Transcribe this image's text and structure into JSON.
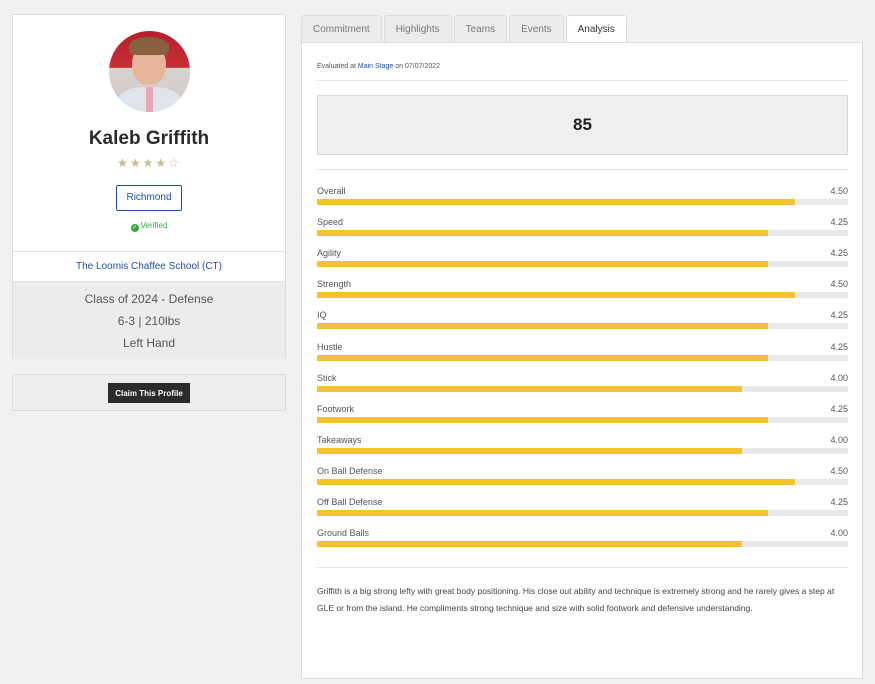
{
  "profile": {
    "name": "Kaleb Griffith",
    "stars": "★★★★",
    "stars_empty": "☆",
    "rating_stars": 4,
    "team": "Richmond",
    "verified": "Verified",
    "school": "The Loomis Chaffee School (CT)",
    "class_position": "Class of 2024 - Defense",
    "height_weight": "6-3 | 210lbs",
    "hand": "Left Hand",
    "claim_label": "Claim This Profile"
  },
  "tabs": [
    "Commitment",
    "Highlights",
    "Teams",
    "Events",
    "Analysis"
  ],
  "active_tab": 4,
  "analysis": {
    "eval_prefix": "Evaluated at",
    "eval_event": "Main Stage",
    "eval_on": "on",
    "eval_date": "07/07/2022",
    "score": "85",
    "max_value": 5,
    "metrics": [
      {
        "label": "Overall",
        "value": "4.50"
      },
      {
        "label": "Speed",
        "value": "4.25"
      },
      {
        "label": "Agility",
        "value": "4.25"
      },
      {
        "label": "Strength",
        "value": "4.50"
      },
      {
        "label": "IQ",
        "value": "4.25"
      },
      {
        "label": "Hustle",
        "value": "4.25"
      },
      {
        "label": "Stick",
        "value": "4.00"
      },
      {
        "label": "Footwork",
        "value": "4.25"
      },
      {
        "label": "Takeaways",
        "value": "4.00"
      },
      {
        "label": "On Ball Defense",
        "value": "4.50"
      },
      {
        "label": "Off Ball Defense",
        "value": "4.25"
      },
      {
        "label": "Ground Balls",
        "value": "4.00"
      }
    ],
    "notes": "Griffith is a big strong lefty with great body positioning. His close out ability and technique is extremely strong and he rarely gives a step at GLE or from the island. He compliments strong technique and size with solid footwork and defensive understanding."
  },
  "colors": {
    "bar_fill": "#f5c12e",
    "link": "#1f4ea8",
    "verified": "#3aa845"
  }
}
